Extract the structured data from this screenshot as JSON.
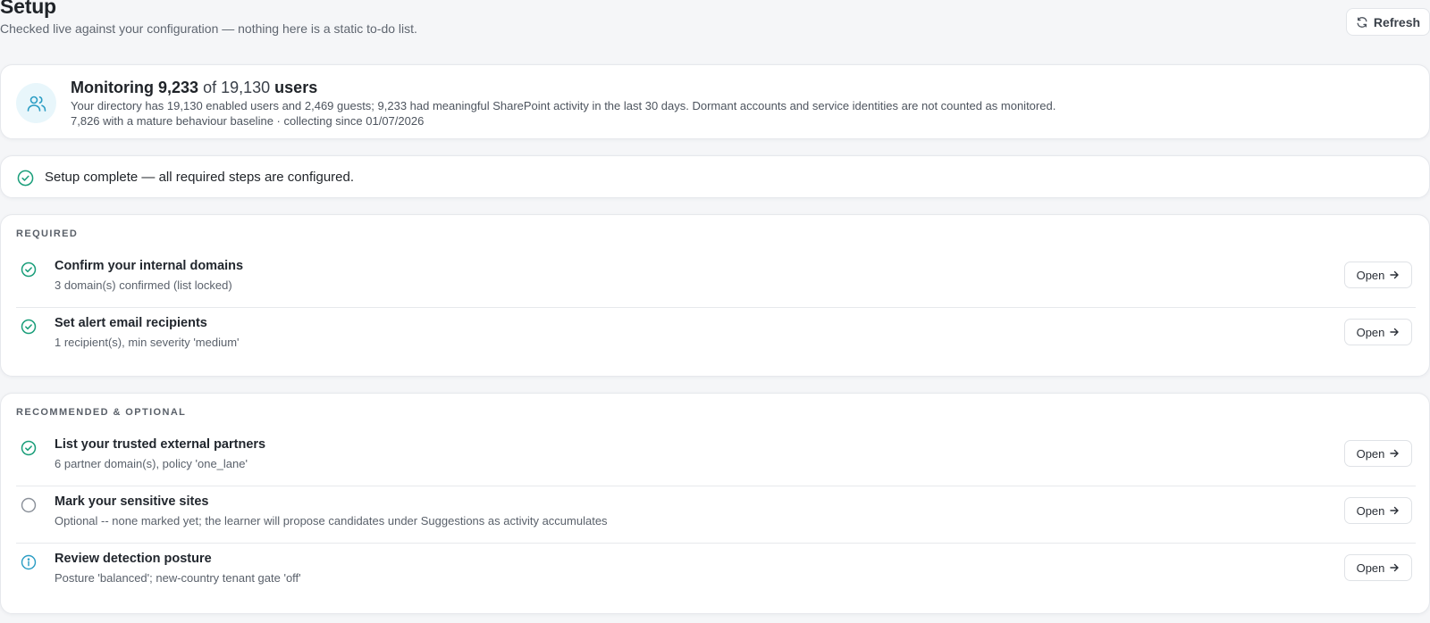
{
  "header": {
    "title": "Setup",
    "subtitle": "Checked live against your configuration — nothing here is a static to-do list.",
    "refresh_label": "Refresh"
  },
  "monitoring": {
    "prefix": "Monitoring",
    "monitored_count": "9,233",
    "of_label": "of",
    "total_count": "19,130",
    "users_label": "users",
    "description": "Your directory has 19,130 enabled users and 2,469 guests; 9,233 had meaningful SharePoint activity in the last 30 days. Dormant accounts and service identities are not counted as monitored.",
    "meta": "7,826 with a mature behaviour baseline · collecting since 01/07/2026"
  },
  "status": {
    "text": "Setup complete — all required steps are configured."
  },
  "required": {
    "label": "REQUIRED",
    "items": [
      {
        "title": "Confirm your internal domains",
        "desc": "3 domain(s) confirmed (list locked)",
        "state": "done",
        "button": "Open"
      },
      {
        "title": "Set alert email recipients",
        "desc": "1 recipient(s), min severity 'medium'",
        "state": "done",
        "button": "Open"
      }
    ]
  },
  "optional": {
    "label": "RECOMMENDED & OPTIONAL",
    "items": [
      {
        "title": "List your trusted external partners",
        "desc": "6 partner domain(s), policy 'one_lane'",
        "state": "done",
        "button": "Open"
      },
      {
        "title": "Mark your sensitive sites",
        "desc": "Optional -- none marked yet; the learner will propose candidates under Suggestions as activity accumulates",
        "state": "pending",
        "button": "Open"
      },
      {
        "title": "Review detection posture",
        "desc": "Posture 'balanced'; new-country tenant gate 'off'",
        "state": "info",
        "button": "Open"
      }
    ]
  },
  "colors": {
    "success": "#1a9e7a",
    "info": "#2b9dc4",
    "pending": "#8a9099",
    "avatar_bg": "#e8f6fb"
  }
}
